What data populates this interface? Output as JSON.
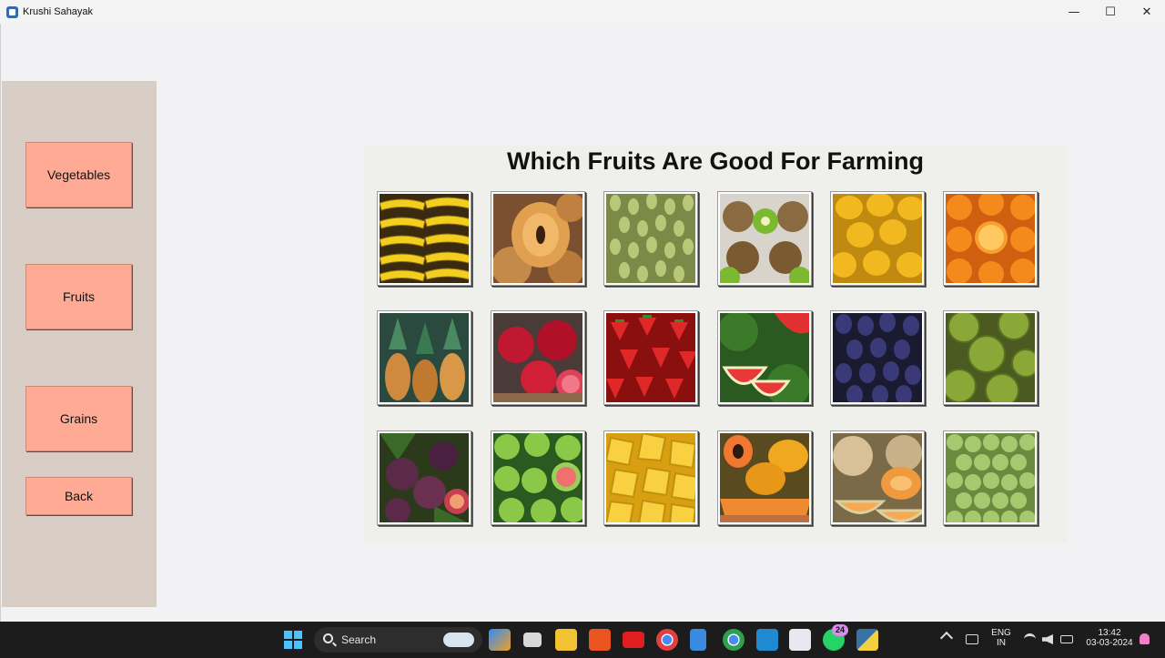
{
  "window": {
    "title": "Krushi Sahayak",
    "minimize": "—",
    "maximize": "☐",
    "close": "✕"
  },
  "sidebar": {
    "buttons": [
      {
        "label": "Vegetables"
      },
      {
        "label": "Fruits"
      },
      {
        "label": "Grains"
      },
      {
        "label": "Back"
      }
    ]
  },
  "panel": {
    "title": "Which Fruits Are Good For Farming",
    "tiles": [
      {
        "icon": "banana-image"
      },
      {
        "icon": "sapota-image"
      },
      {
        "icon": "grapes-image"
      },
      {
        "icon": "kiwi-image"
      },
      {
        "icon": "mango-image"
      },
      {
        "icon": "orange-image"
      },
      {
        "icon": "pineapple-image"
      },
      {
        "icon": "pomegranate-image"
      },
      {
        "icon": "strawberry-image"
      },
      {
        "icon": "watermelon-image"
      },
      {
        "icon": "jamun-image"
      },
      {
        "icon": "custard-apple-image"
      },
      {
        "icon": "fig-image"
      },
      {
        "icon": "guava-image"
      },
      {
        "icon": "jackfruit-image"
      },
      {
        "icon": "papaya-image"
      },
      {
        "icon": "muskmelon-image"
      },
      {
        "icon": "amla-image"
      }
    ]
  },
  "taskbar": {
    "search_label": "Search",
    "lang_line1": "ENG",
    "lang_line2": "IN",
    "time": "13:42",
    "date": "03-03-2024",
    "whatsapp_badge": "24"
  },
  "colors": {
    "button": "#ffaa94",
    "sidebar": "#d8cdc4",
    "panel": "#efefec",
    "taskbar": "#1c1c1c"
  }
}
